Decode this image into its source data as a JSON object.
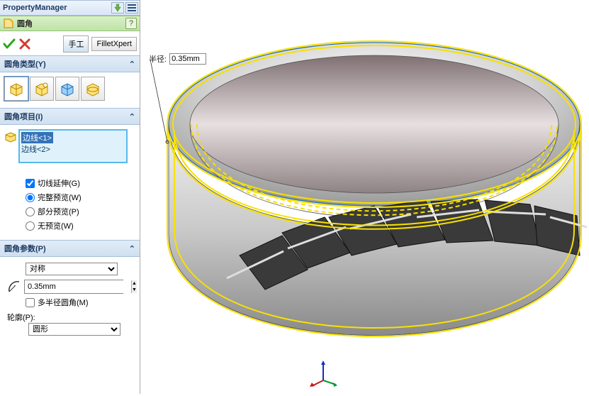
{
  "title": "PropertyManager",
  "feature": {
    "name": "圆角",
    "help": "?"
  },
  "tabs": {
    "manual": "手工",
    "expert": "FilletXpert"
  },
  "sections": {
    "type": "圆角类型(Y)",
    "items": "圆角项目(I)",
    "params": "圆角参数(P)"
  },
  "edges": {
    "e1": "边线<1>",
    "e2": "边线<2>"
  },
  "options": {
    "tangent": "切线延伸(G)",
    "full": "完整预览(W)",
    "partial": "部分预览(P)",
    "none": "无预览(W)"
  },
  "params": {
    "symmetry": "对称",
    "radius": "0.35mm",
    "multi": "多半径圆角(M)",
    "profile_label": "轮廓(P):",
    "profile": "圆形"
  },
  "callout": {
    "label": "半径:",
    "value": "0.35mm"
  }
}
